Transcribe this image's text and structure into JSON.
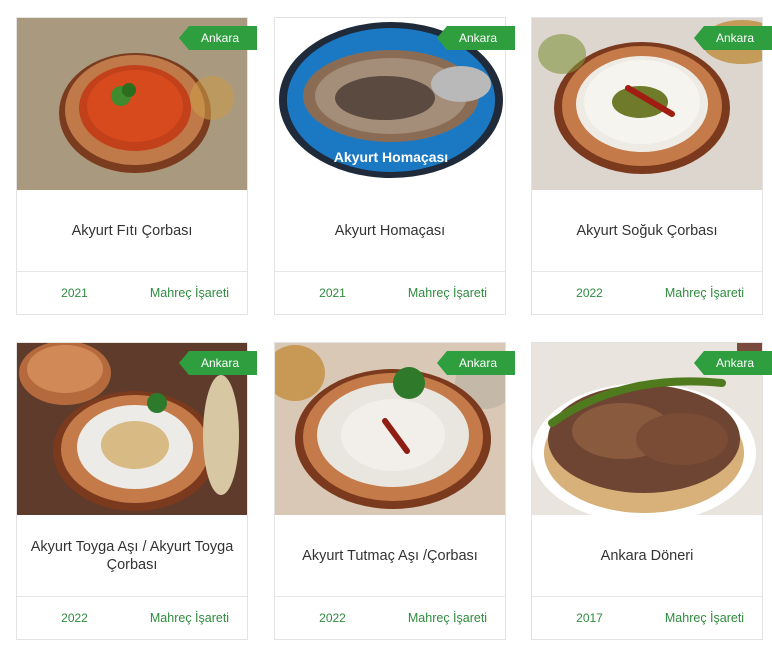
{
  "cards": [
    {
      "region": "Ankara",
      "title": "Akyurt Fıtı Çorbası",
      "year": "2021",
      "label": "Mahreç İşareti"
    },
    {
      "region": "Ankara",
      "title": "Akyurt Homaçası",
      "year": "2021",
      "label": "Mahreç İşareti",
      "image_caption": "Akyurt Homaçası"
    },
    {
      "region": "Ankara",
      "title": "Akyurt Soğuk Çorbası",
      "year": "2022",
      "label": "Mahreç İşareti"
    },
    {
      "region": "Ankara",
      "title": "Akyurt Toyga Aşı / Akyurt Toyga Çorbası",
      "year": "2022",
      "label": "Mahreç İşareti"
    },
    {
      "region": "Ankara",
      "title": "Akyurt Tutmaç Aşı /Çorbası",
      "year": "2022",
      "label": "Mahreç İşareti"
    },
    {
      "region": "Ankara",
      "title": "Ankara Döneri",
      "year": "2017",
      "label": "Mahreç İşareti"
    }
  ],
  "colors": {
    "accent": "#2f9e3f",
    "link": "#2e8b3e"
  }
}
